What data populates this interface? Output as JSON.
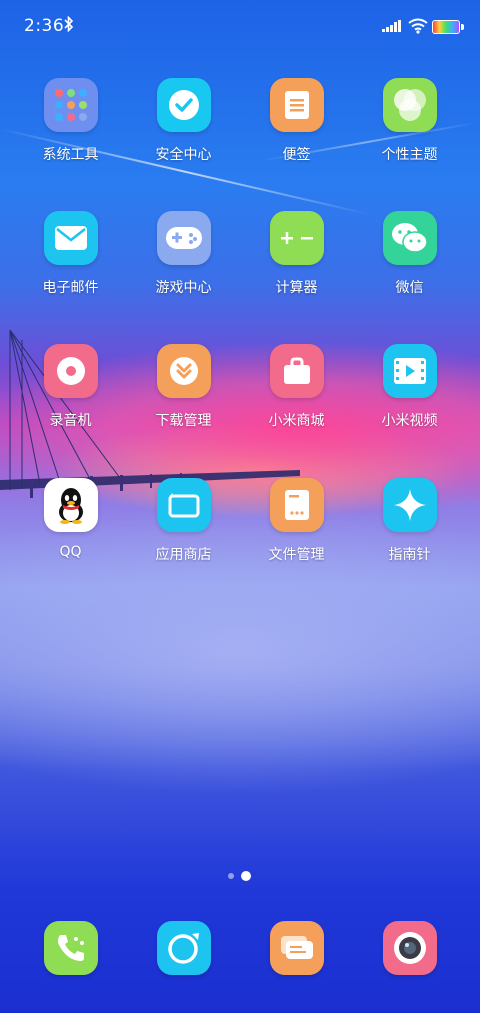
{
  "status": {
    "time": "2:36"
  },
  "apps": [
    {
      "label": "系统工具",
      "color": "#6f8ff0"
    },
    {
      "label": "安全中心",
      "color": "#19c8f0"
    },
    {
      "label": "便签",
      "color": "#f5a05a"
    },
    {
      "label": "个性主题",
      "color": "#8fdc55"
    },
    {
      "label": "电子邮件",
      "color": "#1dc4f0"
    },
    {
      "label": "游戏中心",
      "color": "#8aa9ee"
    },
    {
      "label": "计算器",
      "color": "#8fdc55"
    },
    {
      "label": "微信",
      "color": "#34d39a"
    },
    {
      "label": "录音机",
      "color": "#f36b8a"
    },
    {
      "label": "下载管理",
      "color": "#f5a05a"
    },
    {
      "label": "小米商城",
      "color": "#f36b8a"
    },
    {
      "label": "小米视频",
      "color": "#1dc4f0"
    },
    {
      "label": "QQ",
      "color": "#ffffff"
    },
    {
      "label": "应用商店",
      "color": "#1dc4f0"
    },
    {
      "label": "文件管理",
      "color": "#f5a05a"
    },
    {
      "label": "指南针",
      "color": "#1dc4f0"
    }
  ],
  "dock": [
    {
      "name": "phone",
      "color": "#8fdc55"
    },
    {
      "name": "browser",
      "color": "#1dc4f0"
    },
    {
      "name": "messages",
      "color": "#f5a05a"
    },
    {
      "name": "camera",
      "color": "#f36b8a"
    }
  ],
  "pager": {
    "pages": 2,
    "current": 2
  }
}
